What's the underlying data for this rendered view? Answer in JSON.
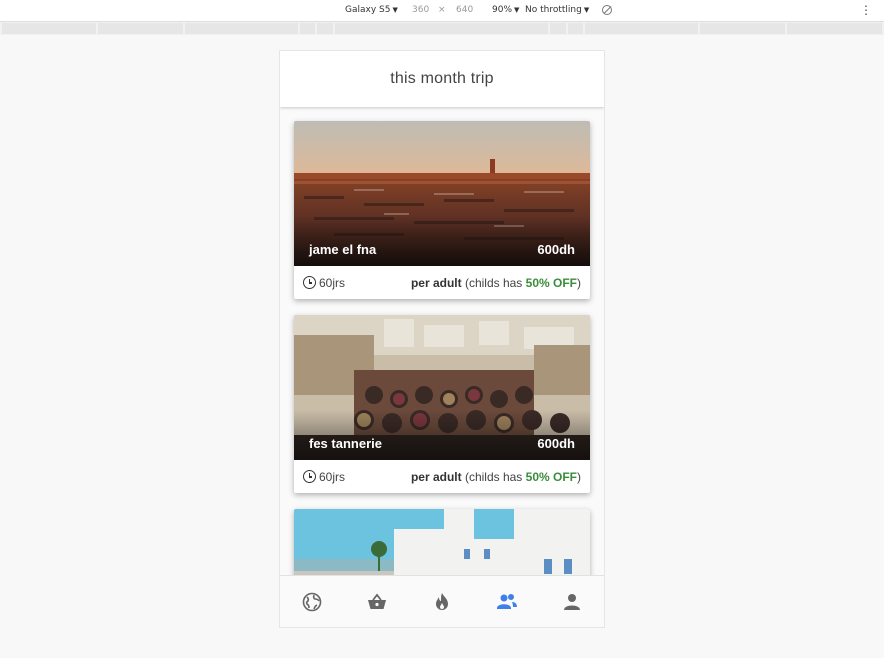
{
  "devtools": {
    "device": "Galaxy S5",
    "width": "360",
    "times": "×",
    "height": "640",
    "zoom": "90%",
    "throttling": "No throttling",
    "more": "⋮"
  },
  "header": {
    "title": "this month trip"
  },
  "cards": [
    {
      "title": "jame el fna",
      "price": "600dh",
      "duration": "60jrs",
      "per_adult": "per adult",
      "childs_text_a": " (childs has ",
      "discount": "50% OFF",
      "childs_text_b": ")"
    },
    {
      "title": "fes tannerie",
      "price": "600dh",
      "duration": "60jrs",
      "per_adult": "per adult",
      "childs_text_a": " (childs has ",
      "discount": "50% OFF",
      "childs_text_b": ")"
    }
  ],
  "nav": [
    {
      "icon": "globe-icon",
      "active": false
    },
    {
      "icon": "basket-icon",
      "active": false
    },
    {
      "icon": "fire-icon",
      "active": false
    },
    {
      "icon": "group-icon",
      "active": true
    },
    {
      "icon": "person-icon",
      "active": false
    }
  ],
  "colors": {
    "accent": "#3f7fe8",
    "discount": "#3a8d3a",
    "icon": "#666666"
  }
}
